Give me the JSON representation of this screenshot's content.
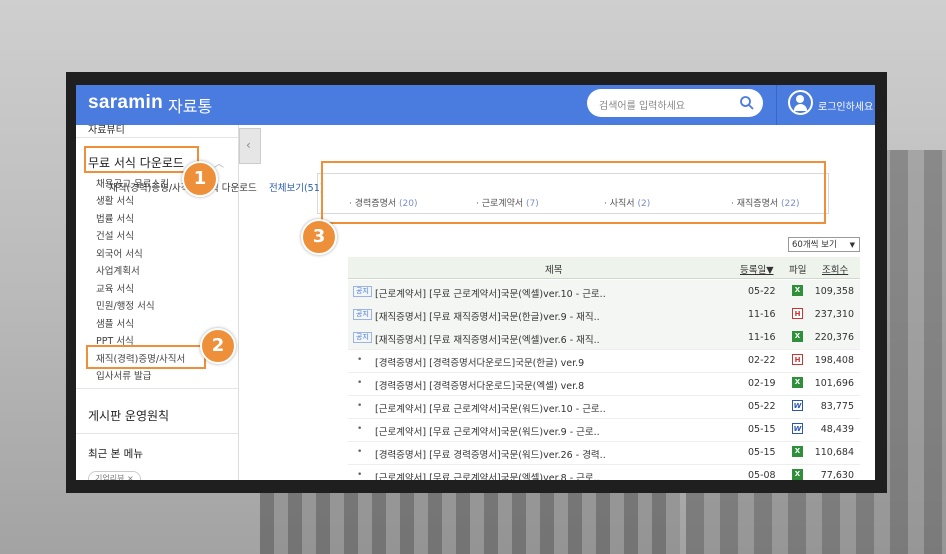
{
  "header": {
    "logo": "saramin",
    "logo_sub": "자료통",
    "search_placeholder": "검색어를 입력하세요",
    "login_label": "로그인하세요"
  },
  "sidebar": {
    "top_item": "자료뷰티",
    "section_title": "무료 서식 다운로드",
    "items": [
      "채용공고 무료스킨",
      "생활 서식",
      "법률 서식",
      "건설 서식",
      "외국어 서식",
      "사업계획서",
      "교육 서식",
      "민원/행정 서식",
      "샘플 서식",
      "PPT 서식",
      "재직(경력)증명/사직서",
      "입사서류 발급"
    ],
    "board_rules": "게시판 운영원칙",
    "recent_menu": "최근 본 메뉴",
    "recent_tag": "기업리뷰 ×"
  },
  "category": {
    "title": "재직(경력)증명/사직서 서식 다운로드",
    "view_all": "전체보기(51)",
    "links": [
      {
        "label": "경력증명서",
        "count": "(20)"
      },
      {
        "label": "근로계약서",
        "count": "(7)"
      },
      {
        "label": "사직서",
        "count": "(2)"
      },
      {
        "label": "재직증명서",
        "count": "(22)"
      }
    ]
  },
  "list": {
    "per_page": "60개씩 보기",
    "columns": {
      "title": "제목",
      "date": "등록일▼",
      "file": "파일",
      "views": "조회수"
    },
    "notice_label": "공지",
    "rows": [
      {
        "notice": true,
        "title": "[근로계약서] [무료 근로계약서]국문(엑셀)ver.10 - 근로..",
        "date": "05-22",
        "file": "x",
        "views": "109,358"
      },
      {
        "notice": true,
        "title": "[재직증명서] [무료 재직증명서]국문(한글)ver.9 - 재직..",
        "date": "11-16",
        "file": "h",
        "views": "237,310"
      },
      {
        "notice": true,
        "title": "[재직증명서] [무료 재직증명서]국문(엑셀)ver.6 - 재직..",
        "date": "11-16",
        "file": "x",
        "views": "220,376"
      },
      {
        "notice": false,
        "title": "[경력증명서] [경력증명서다운로드]국문(한글) ver.9",
        "date": "02-22",
        "file": "h",
        "views": "198,408"
      },
      {
        "notice": false,
        "title": "[경력증명서] [경력증명서다운로드]국문(엑셀) ver.8",
        "date": "02-19",
        "file": "x",
        "views": "101,696"
      },
      {
        "notice": false,
        "title": "[근로계약서] [무료 근로계약서]국문(워드)ver.10 - 근로..",
        "date": "05-22",
        "file": "w",
        "views": "83,775"
      },
      {
        "notice": false,
        "title": "[근로계약서] [무료 근로계약서]국문(워드)ver.9 - 근로..",
        "date": "05-15",
        "file": "w",
        "views": "48,439"
      },
      {
        "notice": false,
        "title": "[경력증명서] [무료 경력증명서]국문(워드)ver.26 - 경력..",
        "date": "05-15",
        "file": "x",
        "views": "110,684"
      },
      {
        "notice": false,
        "title": "[근로계약서] [무료 근로계약서]국문(엑셀)ver.8 - 근로..",
        "date": "05-08",
        "file": "x",
        "views": "77,630"
      }
    ]
  },
  "annotations": [
    "1",
    "2",
    "3"
  ],
  "colors": {
    "brand": "#4a7bde",
    "annotation": "#ee8f3a"
  }
}
